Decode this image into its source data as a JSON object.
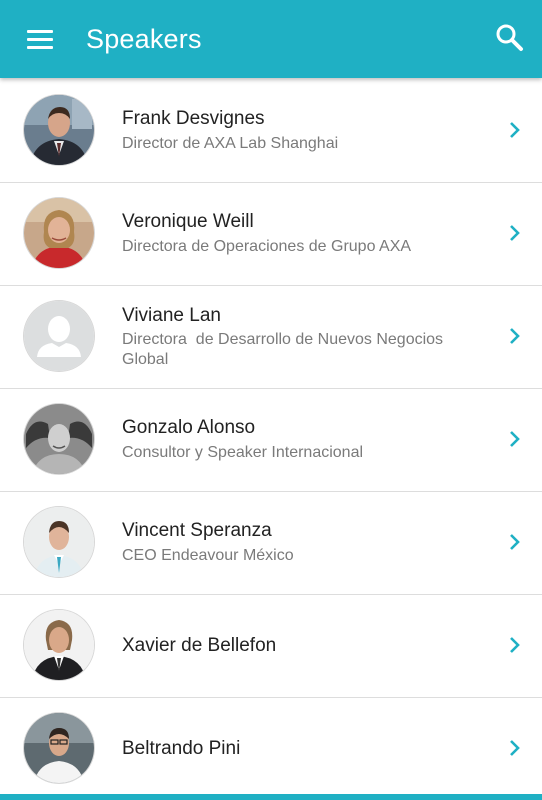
{
  "app": {
    "title": "Speakers",
    "accent_color": "#1fb0c4",
    "menu_icon": "hamburger-menu-icon",
    "search_icon": "search-icon"
  },
  "speakers": [
    {
      "name": "Frank Desvignes",
      "role": "Director de AXA Lab Shanghai",
      "avatar": "photo"
    },
    {
      "name": "Veronique Weill",
      "role": "Directora de Operaciones de Grupo AXA",
      "avatar": "photo"
    },
    {
      "name": "Viviane Lan",
      "role": "Directora  de Desarrollo de Nuevos Negocios Global",
      "avatar": "placeholder-person-icon"
    },
    {
      "name": "Gonzalo Alonso",
      "role": "Consultor y Speaker Internacional",
      "avatar": "photo"
    },
    {
      "name": "Vincent Speranza",
      "role": "CEO Endeavour México",
      "avatar": "photo"
    },
    {
      "name": "Xavier de Bellefon",
      "role": "",
      "avatar": "photo"
    },
    {
      "name": "Beltrando Pini",
      "role": "",
      "avatar": "photo"
    }
  ],
  "row_icon": "chevron-right-icon"
}
